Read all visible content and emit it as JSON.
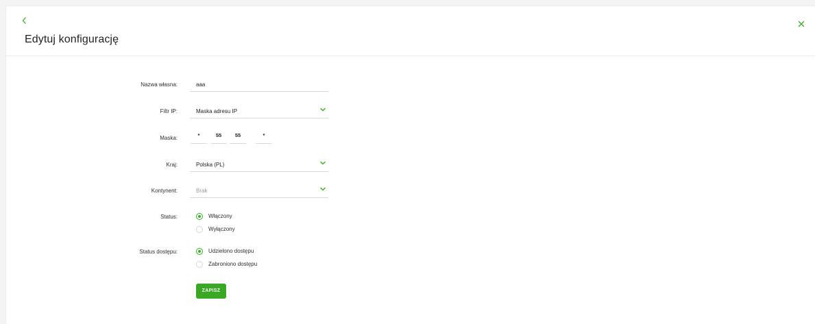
{
  "header": {
    "title": "Edytuj konfigurację",
    "back_icon": "chevron-left-icon",
    "close_icon": "close-icon"
  },
  "colors": {
    "accent": "#3aa824",
    "border": "#d9d9d9"
  },
  "form": {
    "name": {
      "label": "Nazwa własna:",
      "value": "aaa"
    },
    "ip_filter": {
      "label": "Filtr IP:",
      "value": "Maska adresu IP"
    },
    "mask": {
      "label": "Maska:",
      "octets": [
        "*",
        "55",
        "55",
        "*"
      ]
    },
    "country": {
      "label": "Kraj:",
      "value": "Polska (PL)"
    },
    "continent": {
      "label": "Kontynent:",
      "value": "Brak"
    },
    "status": {
      "label": "Status:",
      "options": [
        {
          "label": "Włączony",
          "selected": true
        },
        {
          "label": "Wyłączony",
          "selected": false
        }
      ]
    },
    "access_status": {
      "label": "Status dostępu:",
      "options": [
        {
          "label": "Udzielono dostępu",
          "selected": true
        },
        {
          "label": "Zabroniono dostępu",
          "selected": false
        }
      ]
    },
    "save_label": "ZAPISZ"
  }
}
